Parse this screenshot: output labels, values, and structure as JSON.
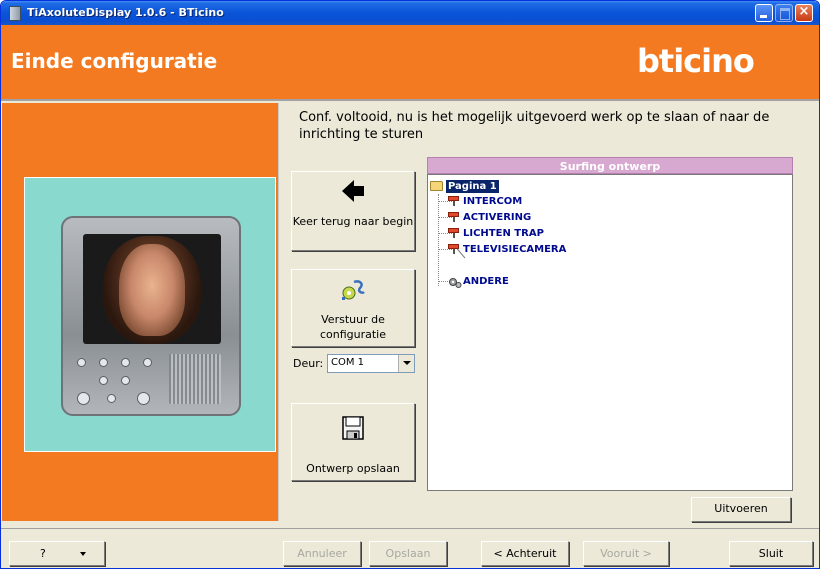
{
  "window": {
    "title": "TiAxoluteDisplay 1.0.6 - BTicino"
  },
  "header": {
    "page_title": "Einde configuratie",
    "brand_logo": "bticino",
    "colors": {
      "band": "#f47a22",
      "text": "#ffffff"
    }
  },
  "main": {
    "intro_text": "Conf. voltooid, nu is het mogelijk uitgevoerd werk op te slaan of naar de inrichting te sturen",
    "actions": {
      "back_label": "Keer terug naar begin",
      "send_label": "Verstuur de configuratie",
      "save_label": "Ontwerp opslaan"
    },
    "port": {
      "label": "Deur:",
      "selected": "COM 1"
    },
    "tree": {
      "header": "Surfing ontwerp",
      "root": "Pagina 1",
      "items": [
        "INTERCOM",
        "ACTIVERING",
        "LICHTEN TRAP",
        "TELEVISIECAMERA"
      ],
      "other": "ANDERE",
      "colors": {
        "header_bg": "#d7a9d1",
        "item_text": "#000a8f",
        "selected_bg": "#0a246a"
      }
    },
    "execute_label": "Uitvoeren"
  },
  "footer": {
    "help_label": "?",
    "cancel_label": "Annuleer",
    "save_label": "Opslaan",
    "back_label": "< Achteruit",
    "next_label": "Vooruit >",
    "close_label": "Sluit"
  }
}
